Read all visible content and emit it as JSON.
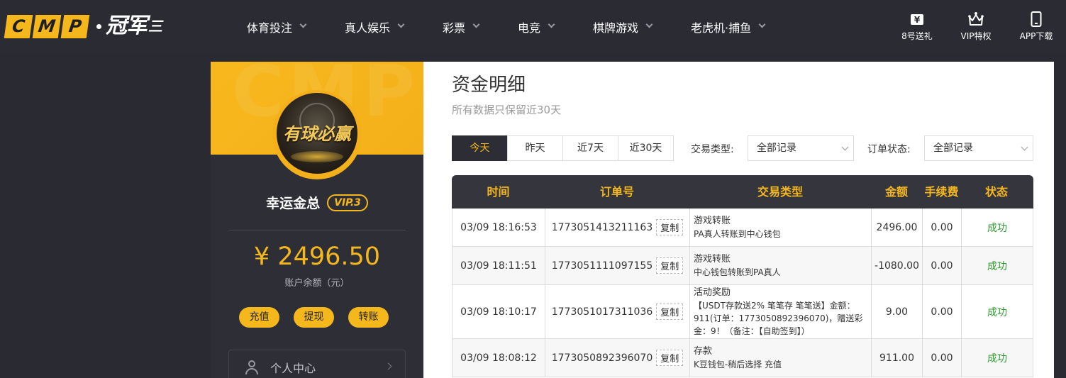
{
  "brand": {
    "logo_letters": [
      "C",
      "M",
      "P"
    ],
    "logo_cn": "冠军",
    "logo_tail": "三"
  },
  "nav": {
    "items": [
      {
        "label": "体育投注"
      },
      {
        "label": "真人娱乐"
      },
      {
        "label": "彩票"
      },
      {
        "label": "电竞"
      },
      {
        "label": "棋牌游戏"
      },
      {
        "label": "老虎机·捕鱼"
      }
    ],
    "tools": [
      {
        "label": "8号送礼",
        "icon": "gift-yen-icon"
      },
      {
        "label": "VIP特权",
        "icon": "crown-icon"
      },
      {
        "label": "APP下载",
        "icon": "phone-icon"
      }
    ]
  },
  "user": {
    "avatar_text": "有球必赢",
    "name": "幸运金总",
    "vip": "VIP.3",
    "balance": "¥ 2496.50",
    "balance_label": "账户余额（元）",
    "actions": [
      "充值",
      "提现",
      "转账"
    ],
    "menu_item": "个人中心",
    "banner_watermark": "CMP"
  },
  "page": {
    "title": "资金明细",
    "subtitle": "所有数据只保留近30天",
    "date_tabs": [
      "今天",
      "昨天",
      "近7天",
      "近30天"
    ],
    "active_tab": 0,
    "filter_type_label": "交易类型:",
    "filter_type_value": "全部记录",
    "filter_status_label": "订单状态:",
    "filter_status_value": "全部记录"
  },
  "table": {
    "headers": [
      "时间",
      "订单号",
      "交易类型",
      "金额",
      "手续费",
      "状态"
    ],
    "copy_label": "复制",
    "rows": [
      {
        "time": "03/09 18:16:53",
        "order": "1773051413211163",
        "type": "游戏转账",
        "detail": "PA真人转账到中心钱包",
        "amount": "2496.00",
        "fee": "0.00",
        "status": "成功"
      },
      {
        "time": "03/09 18:11:51",
        "order": "1773051111097155",
        "type": "游戏转账",
        "detail": "中心钱包转账到PA真人",
        "amount": "-1080.00",
        "fee": "0.00",
        "status": "成功"
      },
      {
        "time": "03/09 18:10:17",
        "order": "1773051017311036",
        "type": "活动奖励",
        "detail": "【USDT存款送2% 笔笔存 笔笔送】金额：911(订单：1773050892396070)，赠送彩金：9！（备注：【自助签到】）",
        "amount": "9.00",
        "fee": "0.00",
        "status": "成功"
      },
      {
        "time": "03/09 18:08:12",
        "order": "1773050892396070",
        "type": "存款",
        "detail": "K豆钱包-稍后选择 充值",
        "amount": "911.00",
        "fee": "0.00",
        "status": "成功"
      }
    ]
  },
  "colors": {
    "accent": "#f5b81c",
    "nav_bg": "#2b2b34",
    "panel_bg": "#2e2e37",
    "success": "#2e9b2e"
  }
}
